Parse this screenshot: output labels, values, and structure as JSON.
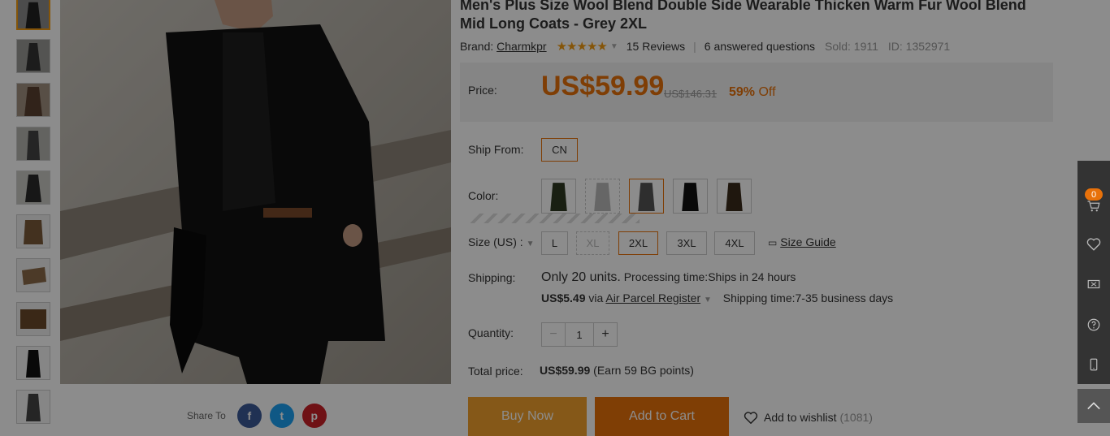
{
  "product": {
    "title": "Men's Plus Size Wool Blend Double Side Wearable Thicken Warm Fur Wool Blend Mid Long Coats - Grey 2XL",
    "brand_label": "Brand:",
    "brand": "Charmkpr",
    "stars": "★★★★★",
    "reviews": "15 Reviews",
    "questions": "6 answered questions",
    "sold": "Sold: 1911",
    "id": "ID: 1352971"
  },
  "price": {
    "label": "Price:",
    "current": "US$59.99",
    "original": "US$146.31",
    "discount_pct": "59%",
    "discount_word": "Off"
  },
  "ship_from": {
    "label": "Ship From:",
    "value": "CN"
  },
  "color": {
    "label": "Color:"
  },
  "size": {
    "label": "Size (US) :",
    "options": [
      "L",
      "XL",
      "2XL",
      "3XL",
      "4XL"
    ],
    "guide": "Size Guide"
  },
  "shipping": {
    "label": "Shipping:",
    "units": "Only 20 units.",
    "processing": "Processing time:Ships in 24 hours",
    "cost": "US$5.49",
    "via": "via",
    "method": "Air Parcel Register",
    "time": "Shipping time:7-35 business days"
  },
  "quantity": {
    "label": "Quantity:",
    "value": "1",
    "minus": "−",
    "plus": "+"
  },
  "total": {
    "label": "Total price:",
    "value": "US$59.99",
    "points": "(Earn 59 BG points)"
  },
  "actions": {
    "buy_now": "Buy Now",
    "add_to_cart": "Add to Cart",
    "wishlist": "Add to wishlist",
    "wishlist_count": "(1081)"
  },
  "share": {
    "label": "Share To",
    "facebook": "f",
    "twitter": "t",
    "pinterest": "p"
  },
  "sidebar": {
    "cart_count": "0"
  },
  "colors": {
    "accent": "#e8710a",
    "buy_now": "#f3a12c",
    "add_to_cart": "#e8710a",
    "facebook": "#3b5998",
    "twitter": "#1da1f2",
    "pinterest": "#cb2027"
  }
}
